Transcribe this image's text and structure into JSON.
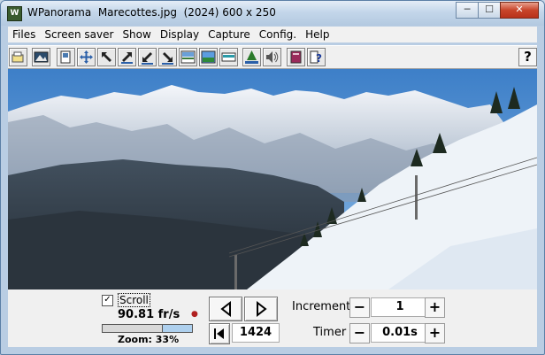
{
  "window": {
    "title": "WPanorama  Marecottes.jpg  (2024) 600 x 250"
  },
  "titlebar_buttons": {
    "minimize": "─",
    "maximize": "☐",
    "close": "✕"
  },
  "menu": [
    "Files",
    "Screen saver",
    "Show",
    "Display",
    "Capture",
    "Config.",
    "Help"
  ],
  "toolbar": {
    "items": [
      "open-icon",
      "image-icon",
      "panel-icon",
      "move-icon",
      "arrow-nw-icon",
      "arrow-ne-icon",
      "arrow-sw-icon",
      "arrow-se-icon",
      "sky-icon",
      "landscape-icon",
      "panorama-icon",
      "tree-icon",
      "speaker-icon",
      "book-icon",
      "help-doc-icon"
    ],
    "help_label": "?"
  },
  "controls": {
    "scroll_checked": "✓",
    "scroll_label": "Scroll",
    "fps": "90.81 fr/s",
    "zoom_label": "Zoom: 33%",
    "zoom_fraction": 0.33,
    "position_value": "1424",
    "increment_label": "Increment",
    "increment_value": "1",
    "timer_label": "Timer",
    "timer_value": "0.01s",
    "minus": "−",
    "plus": "+"
  }
}
